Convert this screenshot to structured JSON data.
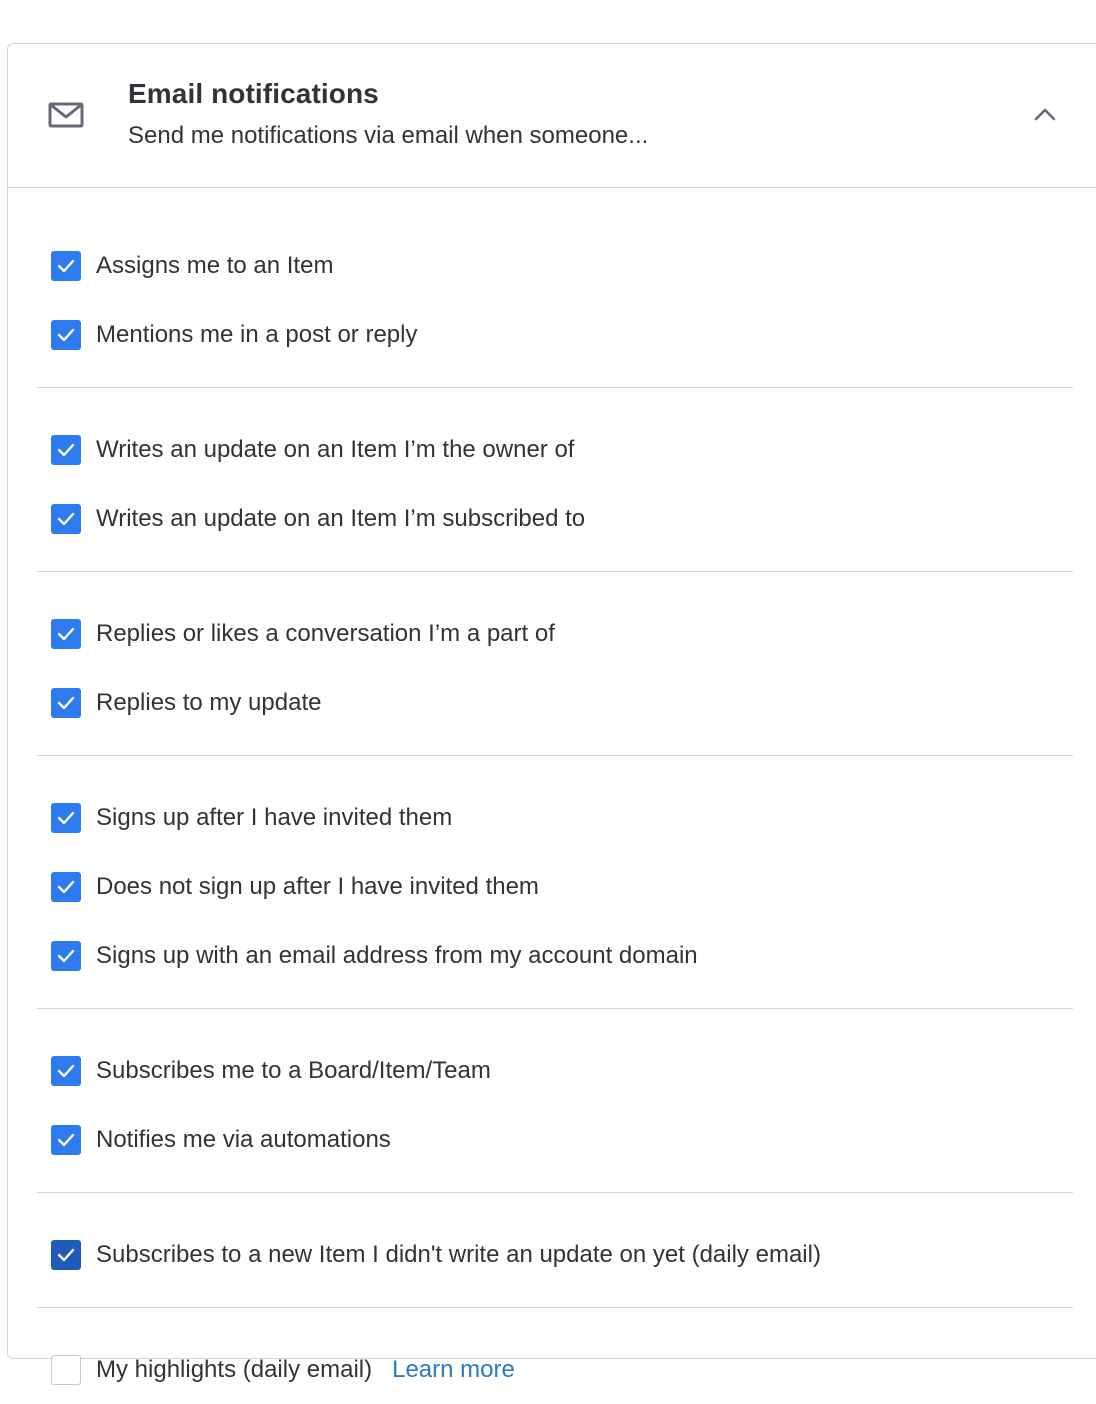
{
  "header": {
    "title": "Email notifications",
    "subtitle": "Send me notifications via email when someone..."
  },
  "icons": {
    "mail": "mail-icon",
    "collapse": "chevron-up-icon",
    "check": "checkmark-icon"
  },
  "colors": {
    "checkbox_checked": "#2e7bef",
    "checkbox_focused": "#1f5bb8",
    "link": "#2a7bc0",
    "divider": "#d0d4e4"
  },
  "groups": [
    {
      "items": [
        {
          "label": "Assigns me to an Item",
          "checked": true
        },
        {
          "label": "Mentions me in a post or reply",
          "checked": true
        }
      ]
    },
    {
      "items": [
        {
          "label": "Writes an update on an Item I’m the owner of",
          "checked": true
        },
        {
          "label": "Writes an update on an Item I’m subscribed to",
          "checked": true
        }
      ]
    },
    {
      "items": [
        {
          "label": "Replies or likes a conversation I’m a part of",
          "checked": true
        },
        {
          "label": "Replies to my update",
          "checked": true
        }
      ]
    },
    {
      "items": [
        {
          "label": "Signs up after I have invited them",
          "checked": true
        },
        {
          "label": "Does not sign up after I have invited them",
          "checked": true
        },
        {
          "label": "Signs up with an email address from my account domain",
          "checked": true
        }
      ]
    },
    {
      "items": [
        {
          "label": "Subscribes me to a Board/Item/Team",
          "checked": true
        },
        {
          "label": "Notifies me via automations",
          "checked": true
        }
      ]
    },
    {
      "items": [
        {
          "label": "Subscribes to a new Item I didn't write an update on yet (daily email)",
          "checked": true
        }
      ]
    },
    {
      "items": [
        {
          "label": "My highlights (daily email)",
          "checked": false,
          "link": "Learn more"
        }
      ]
    }
  ]
}
